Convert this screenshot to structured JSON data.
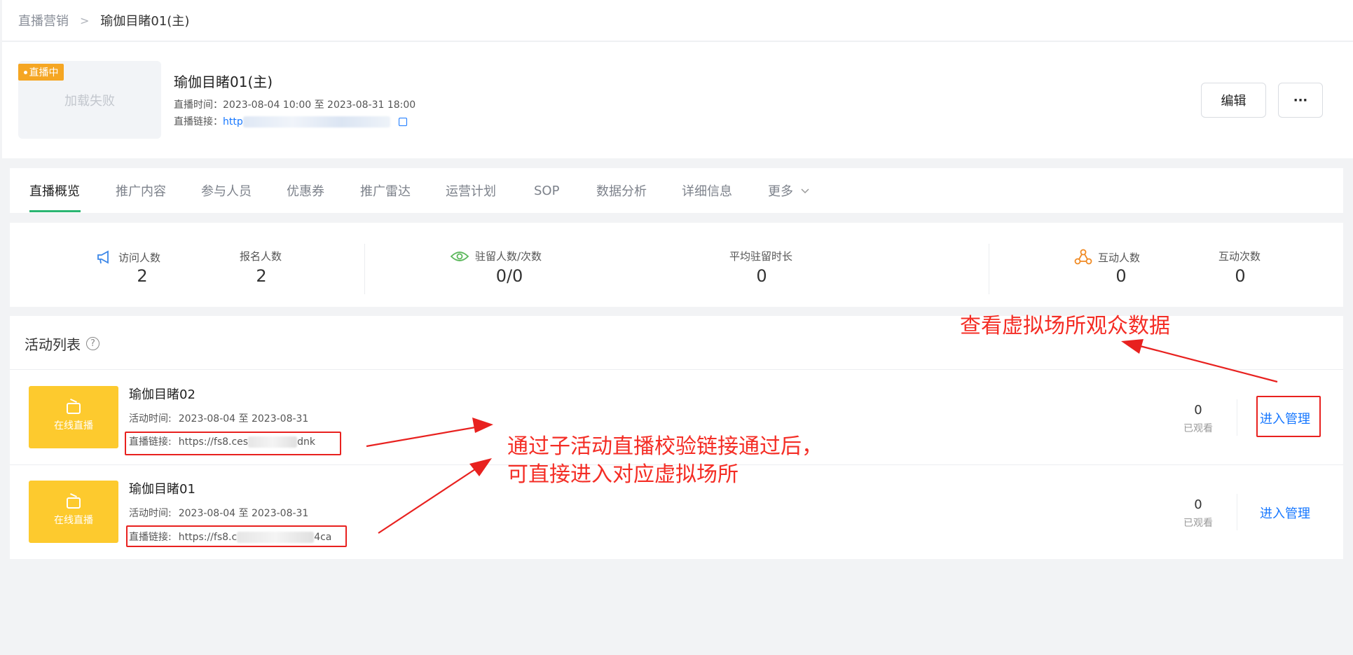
{
  "breadcrumb": {
    "parent": "直播营销",
    "separator": ">",
    "current": "瑜伽目睹01(主)"
  },
  "header": {
    "cover_status": "加载失败",
    "live_badge": "直播中",
    "title": "瑜伽目睹01(主)",
    "time_label": "直播时间：",
    "time_value": "2023-08-04 10:00 至 2023-08-31 18:00",
    "link_label": "直播链接：",
    "link_value": "http",
    "edit_button": "编辑",
    "more_button": "···"
  },
  "tabs": [
    "直播概览",
    "推广内容",
    "参与人员",
    "优惠券",
    "推广雷达",
    "运营计划",
    "SOP",
    "数据分析",
    "详细信息",
    "更多"
  ],
  "stats": {
    "visitors": {
      "label": "访问人数",
      "value": "2"
    },
    "registrants": {
      "label": "报名人数",
      "value": "2"
    },
    "stay": {
      "label": "驻留人数/次数",
      "value": "0/0"
    },
    "avg_stay": {
      "label": "平均驻留时长",
      "value": "0"
    },
    "interact_people": {
      "label": "互动人数",
      "value": "0"
    },
    "interact_count": {
      "label": "互动次数",
      "value": "0"
    }
  },
  "activity_list": {
    "title": "活动列表",
    "help": "?",
    "items": [
      {
        "thumb_label": "在线直播",
        "title": "瑜伽目睹02",
        "time_label": "活动时间:",
        "time_value": "2023-08-04 至 2023-08-31",
        "link_label": "直播链接:",
        "link_start": "https://fs8.ces",
        "link_end": "dnk",
        "count": "0",
        "count_label": "已观看",
        "action": "进入管理"
      },
      {
        "thumb_label": "在线直播",
        "title": "瑜伽目睹01",
        "time_label": "活动时间:",
        "time_value": "2023-08-04 至 2023-08-31",
        "link_label": "直播链接:",
        "link_start": "https://fs8.c",
        "link_end": "4ca",
        "count": "0",
        "count_label": "已观看",
        "action": "进入管理"
      }
    ]
  },
  "annotations": {
    "note_top": "查看虚拟场所观众数据",
    "note_mid_line1": "通过子活动直播校验链接通过后，",
    "note_mid_line2": "可直接进入对应虚拟场所"
  },
  "colors": {
    "accent_green": "#2bb673",
    "link_blue": "#1677ff",
    "annotation_red": "#e8211f",
    "live_orange": "#f5a623",
    "thumb_yellow": "#fdca2e"
  }
}
